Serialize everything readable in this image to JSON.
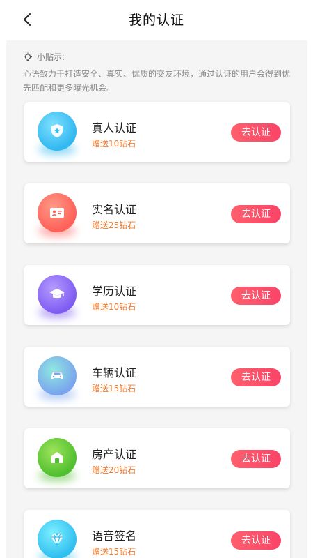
{
  "header": {
    "title": "我的认证"
  },
  "tips": {
    "heading": "小贴示:",
    "text": "心语致力于打造安全、真实、优质的交友环境，通过认证的用户会得到优先匹配和更多曝光机会。"
  },
  "cards": [
    {
      "name": "真人认证",
      "reward": "赠送10钻石",
      "button": "去认证",
      "icon": "shield-star-icon"
    },
    {
      "name": "实名认证",
      "reward": "赠送25钻石",
      "button": "去认证",
      "icon": "id-card-icon"
    },
    {
      "name": "学历认证",
      "reward": "赠送10钻石",
      "button": "去认证",
      "icon": "graduation-cap-icon"
    },
    {
      "name": "车辆认证",
      "reward": "赠送15钻石",
      "button": "去认证",
      "icon": "car-icon"
    },
    {
      "name": "房产认证",
      "reward": "赠送20钻石",
      "button": "去认证",
      "icon": "house-icon"
    },
    {
      "name": "语音签名",
      "reward": "赠送15钻石",
      "button": "去认证",
      "icon": "diamond-icon"
    }
  ],
  "colors": {
    "accent": "#f94468",
    "reward": "#f07a2e"
  }
}
